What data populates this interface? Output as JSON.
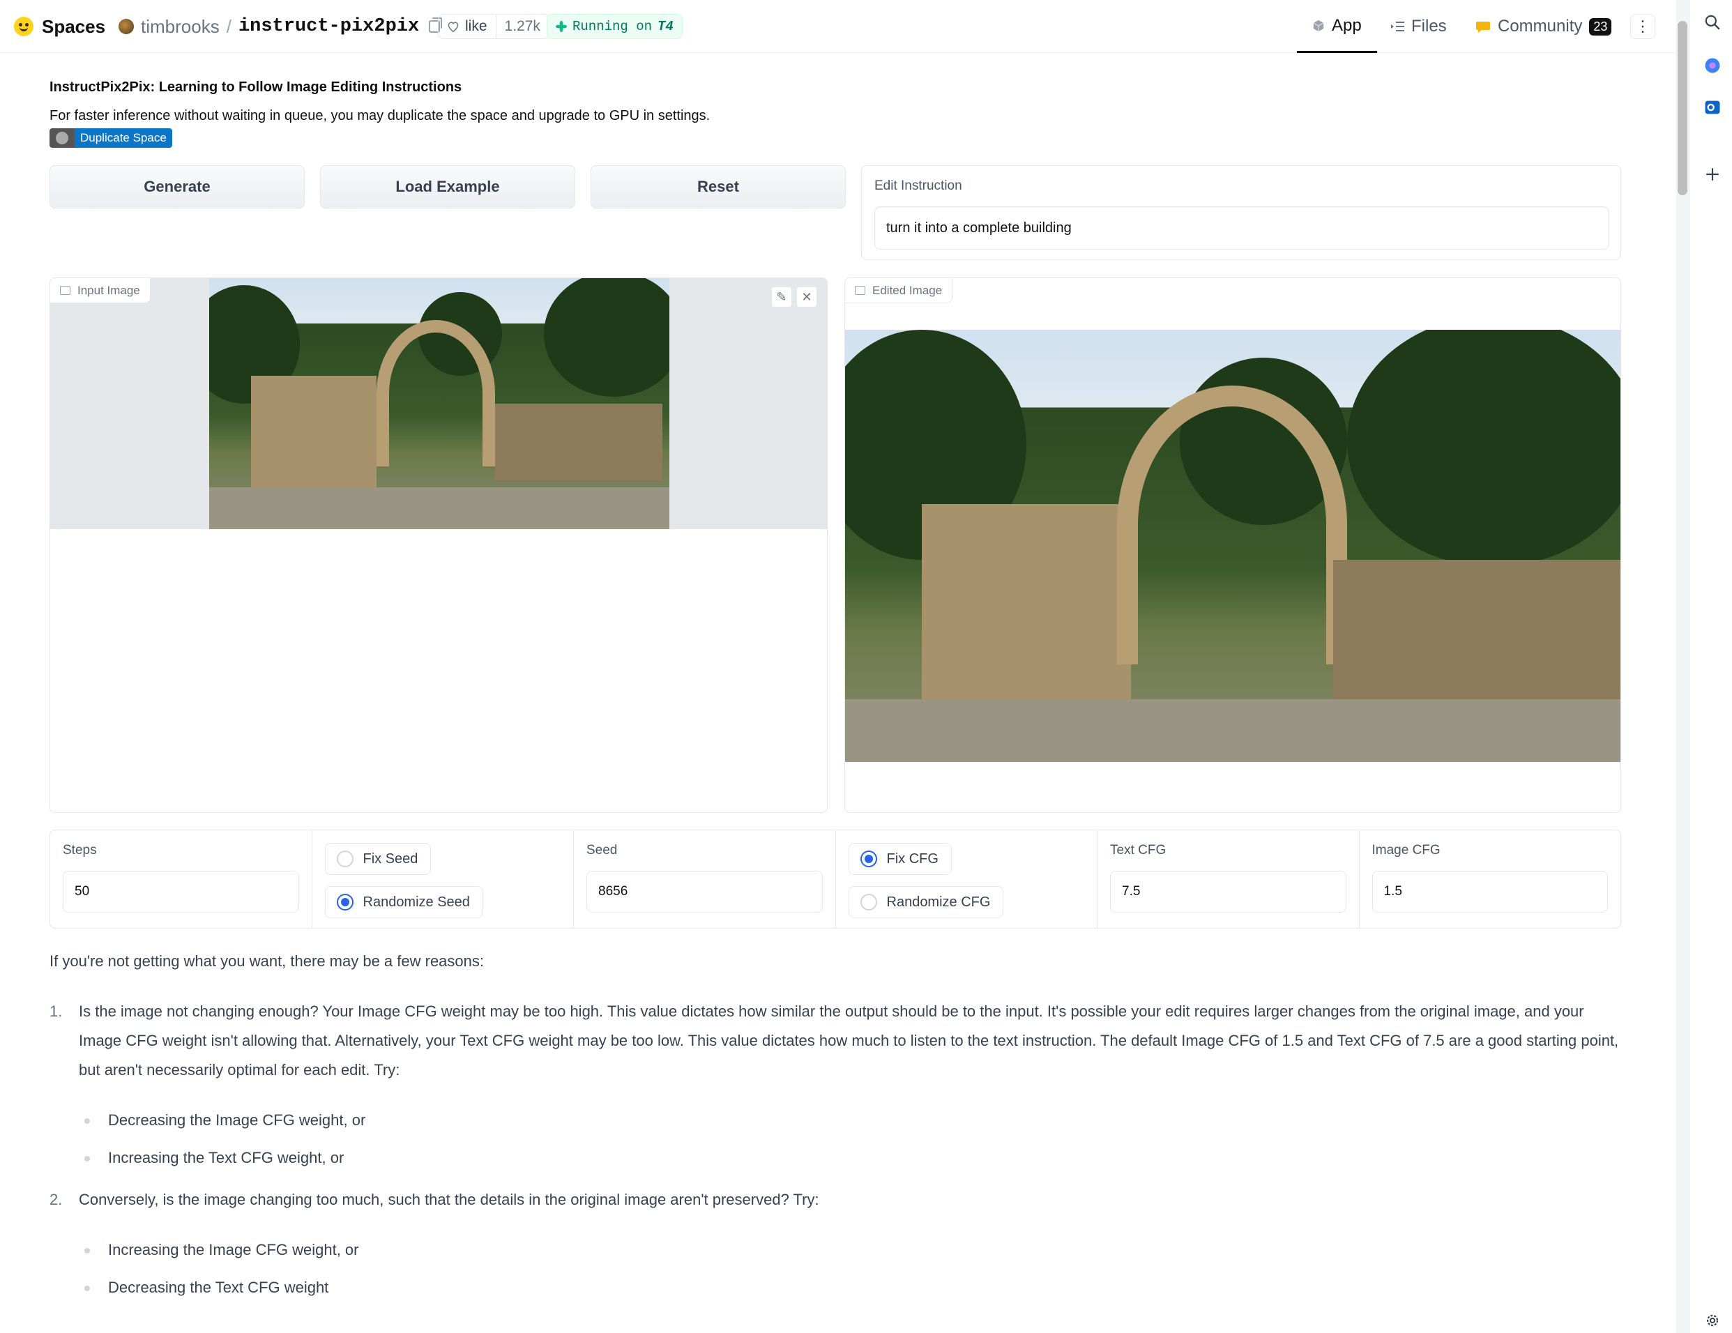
{
  "header": {
    "brand": "Spaces",
    "owner": "timbrooks",
    "separator": "/",
    "repo": "instruct-pix2pix",
    "like_label": "like",
    "like_count": "1.27k",
    "status_prefix": "Running on",
    "status_hw": "T4",
    "tabs": [
      {
        "label": "App",
        "icon": "app-cube-icon",
        "active": true
      },
      {
        "label": "Files",
        "icon": "files-icon",
        "active": false
      },
      {
        "label": "Community",
        "icon": "community-icon",
        "badge": "23",
        "active": false
      }
    ],
    "more_icon": "⋮"
  },
  "page": {
    "title": "InstructPix2Pix: Learning to Follow Image Editing Instructions",
    "subtitle": "For faster inference without waiting in queue, you may duplicate the space and upgrade to GPU in settings.",
    "duplicate_label": "Duplicate Space"
  },
  "actions": {
    "generate": "Generate",
    "load_example": "Load Example",
    "reset": "Reset"
  },
  "instruction": {
    "label": "Edit Instruction",
    "value": "turn it into a complete building"
  },
  "images": {
    "input_label": "Input Image",
    "output_label": "Edited Image",
    "edit_icon": "✎",
    "close_icon": "✕"
  },
  "params": {
    "steps_label": "Steps",
    "steps_value": "50",
    "fix_seed": "Fix Seed",
    "randomize_seed": "Randomize Seed",
    "seed_mode": "Randomize Seed",
    "seed_label": "Seed",
    "seed_value": "8656",
    "fix_cfg": "Fix CFG",
    "randomize_cfg": "Randomize CFG",
    "cfg_mode": "Fix CFG",
    "text_cfg_label": "Text CFG",
    "text_cfg_value": "7.5",
    "image_cfg_label": "Image CFG",
    "image_cfg_value": "1.5"
  },
  "tips": {
    "intro": "If you're not getting what you want, there may be a few reasons:",
    "items": [
      {
        "num": "1.",
        "text": "Is the image not changing enough? Your Image CFG weight may be too high. This value dictates how similar the output should be to the input. It's possible your edit requires larger changes from the original image, and your Image CFG weight isn't allowing that. Alternatively, your Text CFG weight may be too low. This value dictates how much to listen to the text instruction. The default Image CFG of 1.5 and Text CFG of 7.5 are a good starting point, but aren't necessarily optimal for each edit. Try:",
        "bullets": [
          "Decreasing the Image CFG weight, or",
          "Increasing the Text CFG weight, or"
        ]
      },
      {
        "num": "2.",
        "text": "Conversely, is the image changing too much, such that the details in the original image aren't preserved? Try:",
        "bullets": [
          "Increasing the Image CFG weight, or",
          "Decreasing the Text CFG weight"
        ]
      }
    ]
  }
}
